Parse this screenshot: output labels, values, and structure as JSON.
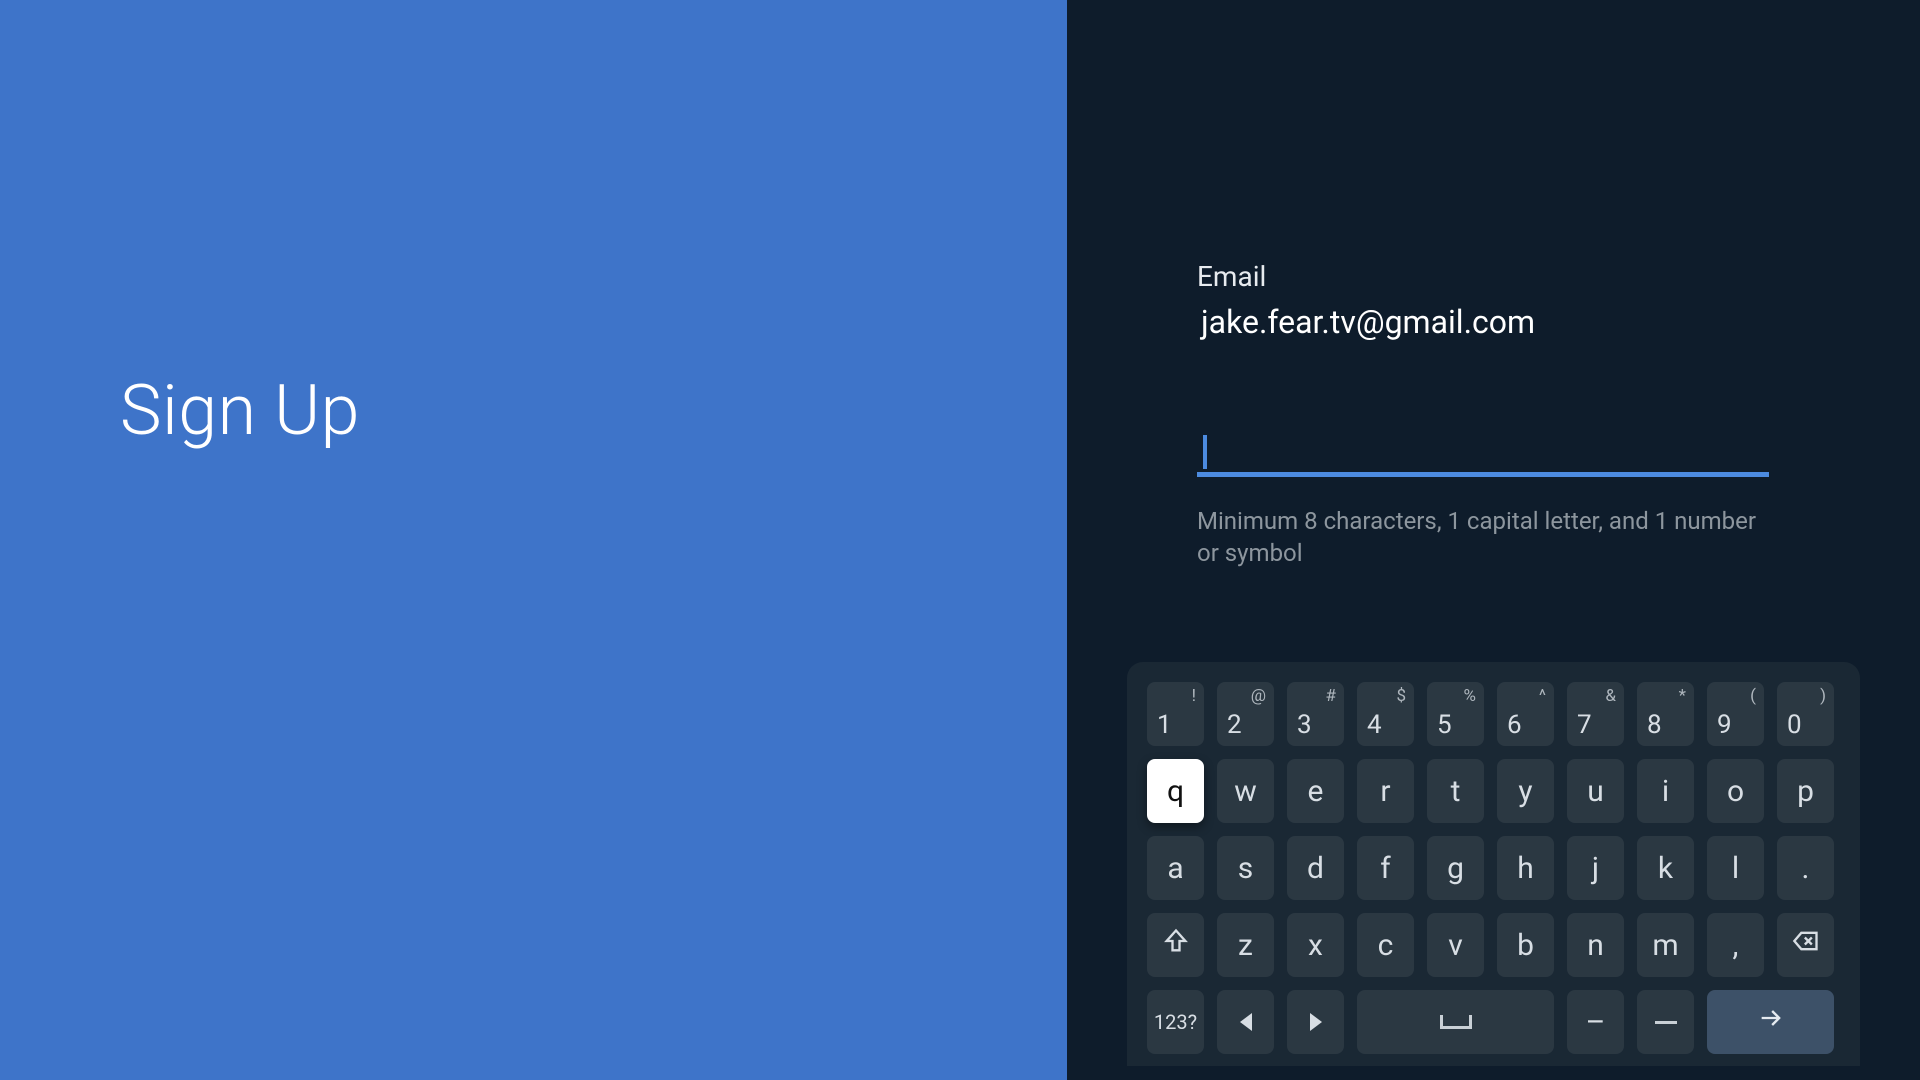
{
  "left": {
    "title": "Sign Up"
  },
  "form": {
    "email_label": "Email",
    "email_value": "jake.fear.tv@gmail.com",
    "password_value": "",
    "helper": "Minimum 8 characters, 1 capital letter, and 1 number or symbol"
  },
  "keyboard": {
    "row_num": [
      {
        "main": "1",
        "sup": "!"
      },
      {
        "main": "2",
        "sup": "@"
      },
      {
        "main": "3",
        "sup": "#"
      },
      {
        "main": "4",
        "sup": "$"
      },
      {
        "main": "5",
        "sup": "%"
      },
      {
        "main": "6",
        "sup": "^"
      },
      {
        "main": "7",
        "sup": "&"
      },
      {
        "main": "8",
        "sup": "*"
      },
      {
        "main": "9",
        "sup": "("
      },
      {
        "main": "0",
        "sup": ")"
      }
    ],
    "row1": [
      "q",
      "w",
      "e",
      "r",
      "t",
      "y",
      "u",
      "i",
      "o",
      "p"
    ],
    "row2": [
      "a",
      "s",
      "d",
      "f",
      "g",
      "h",
      "j",
      "k",
      "l",
      "."
    ],
    "row3_letters": [
      "z",
      "x",
      "c",
      "v",
      "b",
      "n",
      "m",
      ","
    ],
    "mode_label": "123?",
    "dash": "–",
    "focused_key": "q",
    "icons": {
      "shift": "shift-icon",
      "backspace": "backspace-icon",
      "left": "caret-left-icon",
      "right": "caret-right-icon",
      "space": "space-icon",
      "enter": "arrow-right-icon"
    }
  },
  "colors": {
    "left_bg": "#3E74C9",
    "right_bg": "#0E1C2B",
    "accent": "#4C8BE0",
    "key_bg": "#2B3842",
    "keyboard_bg": "#1A2834",
    "enter_bg": "#3D5168"
  }
}
